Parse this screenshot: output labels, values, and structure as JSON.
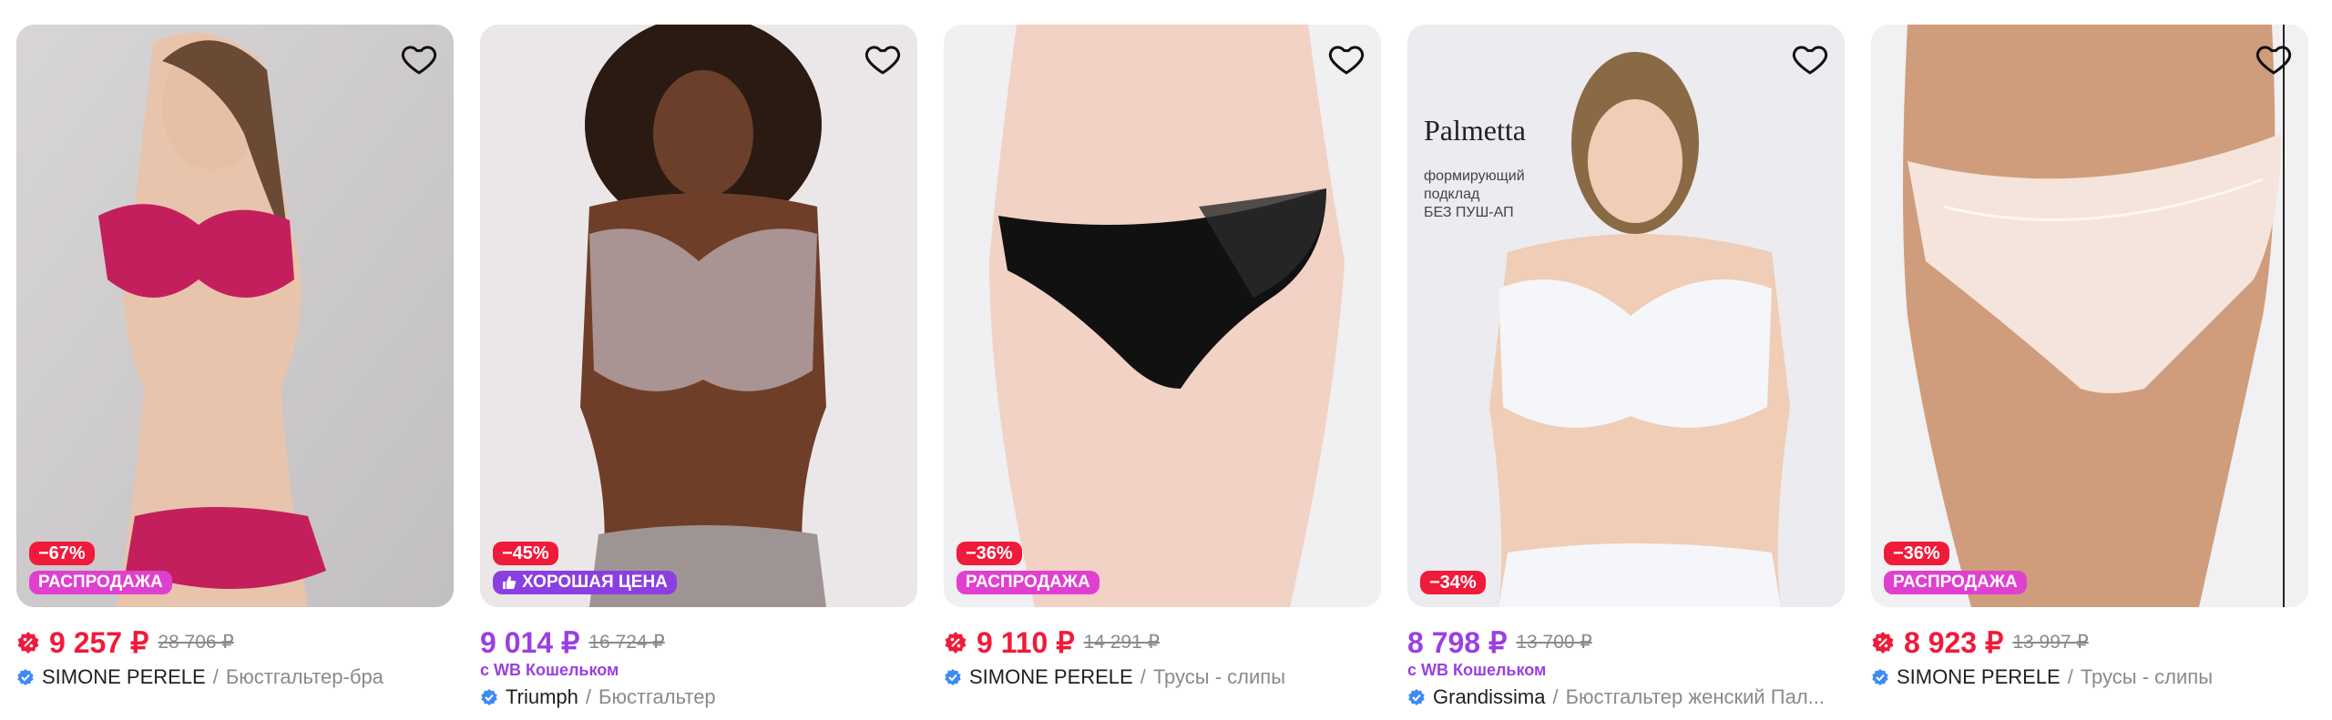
{
  "products": [
    {
      "discount": "−67%",
      "label": "РАСПРОДАЖА",
      "price": "9 257 ₽",
      "old_price": "28 706 ₽",
      "wallet": "",
      "brand": "SIMONE PERELE",
      "separator": "/",
      "title": "Бюстгальтер-бра",
      "price_color": "#f01a3a",
      "icons": [
        "heart-icon",
        "sale-percent-icon",
        "verified-icon"
      ]
    },
    {
      "discount": "−45%",
      "label": "ХОРОШАЯ ЦЕНА",
      "price": "9 014 ₽",
      "old_price": "16 724 ₽",
      "wallet": "с WB Кошельком",
      "brand": "Triumph",
      "separator": "/",
      "title": "Бюстгальтер",
      "price_color": "#9a3fe0",
      "icons": [
        "heart-icon",
        "thumbs-up-icon",
        "verified-icon"
      ]
    },
    {
      "discount": "−36%",
      "label": "РАСПРОДАЖА",
      "price": "9 110 ₽",
      "old_price": "14 291 ₽",
      "wallet": "",
      "brand": "SIMONE PERELE",
      "separator": "/",
      "title": "Трусы - слипы",
      "price_color": "#f01a3a",
      "icons": [
        "heart-icon",
        "sale-percent-icon",
        "verified-icon"
      ]
    },
    {
      "discount": "−34%",
      "label": "",
      "price": "8 798 ₽",
      "old_price": "13 700 ₽",
      "wallet": "с WB Кошельком",
      "brand": "Grandissima",
      "separator": "/",
      "title": "Бюстгальтер женский Пал...",
      "price_color": "#9a3fe0",
      "photo_text": {
        "brand": "Palmetta",
        "line1": "формирующий",
        "line2": "подклад",
        "line3": "БЕЗ ПУШ-АП"
      },
      "icons": [
        "heart-icon",
        "verified-icon"
      ]
    },
    {
      "discount": "−36%",
      "label": "РАСПРОДАЖА",
      "price": "8 923 ₽",
      "old_price": "13 997 ₽",
      "wallet": "",
      "brand": "SIMONE PERELE",
      "separator": "/",
      "title": "Трусы - слипы",
      "price_color": "#f01a3a",
      "icons": [
        "heart-icon",
        "sale-percent-icon",
        "verified-icon"
      ]
    }
  ]
}
